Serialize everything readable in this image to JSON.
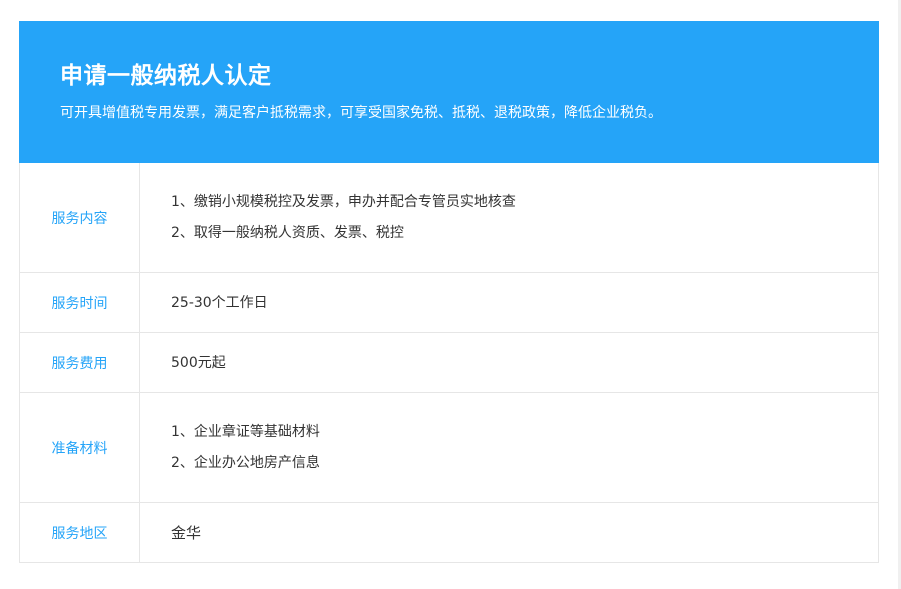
{
  "hero": {
    "title": "申请一般纳税人认定",
    "subtitle": "可开具增值税专用发票，满足客户抵税需求，可享受国家免税、抵税、退税政策，降低企业税负。"
  },
  "rows": [
    {
      "label": "服务内容",
      "lines": [
        "1、缴销小规模税控及发票，申办并配合专管员实地核查",
        "2、取得一般纳税人资质、发票、税控"
      ]
    },
    {
      "label": "服务时间",
      "lines": [
        "25-30个工作日"
      ]
    },
    {
      "label": "服务费用",
      "lines": [
        "500元起"
      ]
    },
    {
      "label": "准备材料",
      "lines": [
        "1、企业章证等基础材料",
        "2、企业办公地房产信息"
      ]
    },
    {
      "label": "服务地区",
      "lines": [
        "金华"
      ]
    }
  ],
  "colors": {
    "accent": "#25a4f8",
    "text": "#333333",
    "border": "#e6e6e6"
  }
}
